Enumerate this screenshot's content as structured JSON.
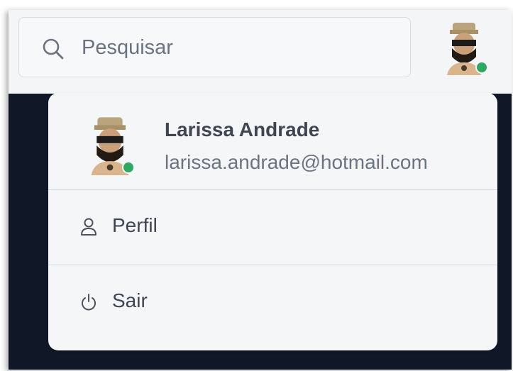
{
  "header": {
    "search": {
      "placeholder": "Pesquisar",
      "icon": "search-icon"
    },
    "avatar": {
      "status": "online",
      "status_color": "#2ea862"
    }
  },
  "user_menu": {
    "user": {
      "name": "Larissa Andrade",
      "email": "larissa.andrade@hotmail.com",
      "status": "online"
    },
    "items": [
      {
        "label": "Perfil",
        "icon": "user-icon"
      },
      {
        "label": "Sair",
        "icon": "power-icon"
      }
    ]
  },
  "colors": {
    "background_dark": "#101828",
    "status_online": "#2ea862",
    "text_primary": "#3f4552",
    "text_secondary": "#6b7480"
  }
}
